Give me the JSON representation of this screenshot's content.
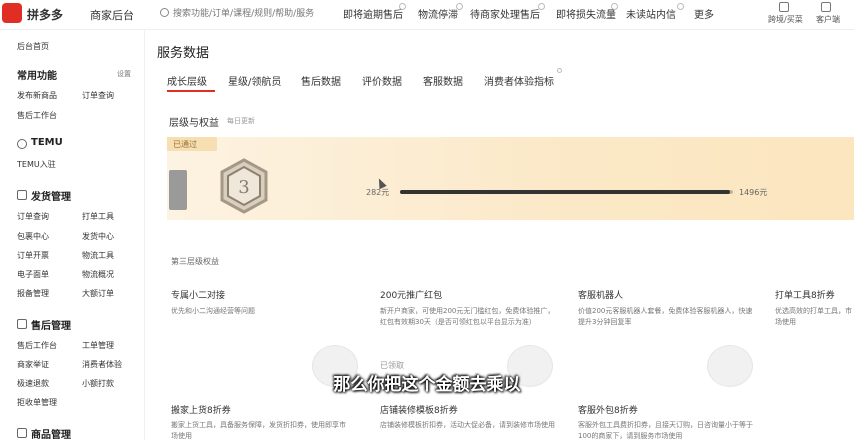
{
  "topbar": {
    "brand": "拼多多",
    "brand_sub": "商家后台",
    "search_placeholder": "搜索功能/订单/课程/规则/帮助/服务",
    "nav": [
      "即将逾期售后",
      "物流停滞",
      "待商家处理售后",
      "即将损失流量",
      "未读站内信",
      "更多"
    ],
    "right_tools": [
      "跨境/买菜",
      "客户端"
    ]
  },
  "sidebar": {
    "home": "后台首页",
    "common_title": "常用功能",
    "common_edit": "设置",
    "common_items": [
      "发布新商品",
      "订单查询",
      "售后工作台"
    ],
    "temu_title": "TEMU",
    "temu_items": [
      "TEMU入驻"
    ],
    "ship_title": "发货管理",
    "ship_items": [
      "订单查询",
      "打单工具",
      "包裹中心",
      "发货中心",
      "订单开票",
      "物流工具",
      "电子面单",
      "物流概况",
      "报备管理",
      "大额订单"
    ],
    "after_title": "售后管理",
    "after_items": [
      "售后工作台",
      "工单管理",
      "商家举证",
      "消费者体验",
      "极速退款",
      "小额打款",
      "拒收单管理"
    ],
    "goods_title": "商品管理"
  },
  "main": {
    "title": "服务数据",
    "tabs": [
      "成长层级",
      "星级/领航员",
      "售后数据",
      "评价数据",
      "客服数据",
      "消费者体验指标"
    ],
    "level_title": "层级与权益",
    "level_note": "每日更新",
    "passed": "已通过",
    "level_num": "3",
    "progress": {
      "start": "282元",
      "end": "1496元",
      "fraction": 0.99
    },
    "benefit_title": "第三层级权益",
    "cards": [
      {
        "title": "专属小二对接",
        "desc": "优先和小二沟通经营等问题"
      },
      {
        "title": "200元推广红包",
        "desc": "新开户商家，可使用200元无门槛红包，免费体验推广，红包有效期30天（是否可领红包以平台显示为准）"
      },
      {
        "title": "客服机器人",
        "desc": "价值200元客服机器人套餐，免费体验客服机器人，快速提升3分钟回复率"
      },
      {
        "title": "打单工具8折券",
        "desc": "优选高效的打单工具，市场使用"
      }
    ],
    "claimed": "已领取",
    "cards2": [
      {
        "title": "搬家上货8折券",
        "desc": "搬家上货工具，具备服务保障，发货折扣券，使用即享市场使用"
      },
      {
        "title": "店铺装修模板8折券",
        "desc": "店铺装修模板折扣券，活动大促必备，请到装修市场使用"
      },
      {
        "title": "客服外包8折券",
        "desc": "客服外包工具费折扣券，且接天订购，日咨询量小于等于100的商家下，请到服务市场使用"
      }
    ]
  },
  "subtitle": "那么你把这个金额去乘以",
  "colors": {
    "brand": "#e02e24",
    "band": "#fbe8c6"
  }
}
